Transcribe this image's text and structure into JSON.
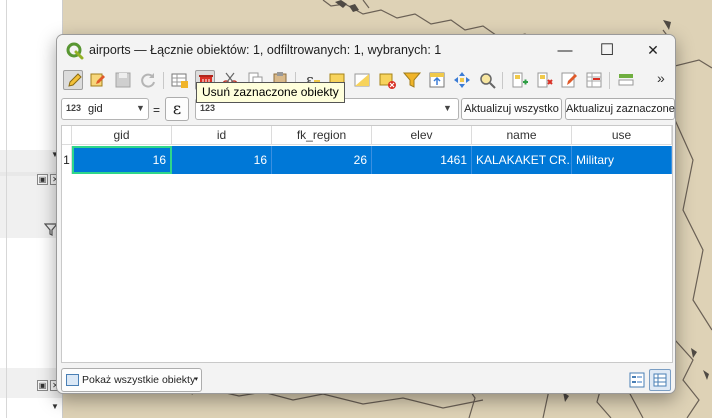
{
  "window": {
    "title": "airports — Łącznie obiektów: 1, odfiltrowanych: 1, wybranych: 1",
    "minimize_glyph": "—",
    "maximize_glyph": "☐",
    "close_glyph": "✕"
  },
  "toolbar": {
    "overflow_glyph": "»",
    "icons": [
      "pencil-edit-icon",
      "multi-edit-icon",
      "save-icon",
      "reload-icon",
      "add-feature-icon",
      "delete-selected-icon",
      "cut-icon",
      "copy-icon",
      "paste-icon",
      "expression-select-icon",
      "select-all-icon",
      "invert-selection-icon",
      "deselect-icon",
      "filter-icon",
      "move-selection-top-icon",
      "pan-to-selection-icon",
      "zoom-to-selection-icon",
      "new-field-icon",
      "delete-field-icon",
      "field-calculator-icon",
      "conditional-format-icon",
      "dock-icon"
    ]
  },
  "tooltip": {
    "text": "Usuń zaznaczone obiekty"
  },
  "filterbar": {
    "field_type": "123",
    "field_name": "gid",
    "equals": "=",
    "expression_glyph": "ε",
    "value_type": "123",
    "update_all_label": "Aktualizuj wszystko",
    "update_selected_label": "Aktualizuj zaznaczone"
  },
  "table": {
    "columns": [
      "gid",
      "id",
      "fk_region",
      "elev",
      "name",
      "use"
    ],
    "rows": [
      {
        "row_number": "1",
        "gid": "16",
        "id": "16",
        "fk_region": "26",
        "elev": "1461",
        "name": "KALAKAKET CR...",
        "use": "Military"
      }
    ]
  },
  "bottombar": {
    "filter_label": "Pokaż wszystkie obiekty"
  },
  "colors": {
    "selection": "#0078d7",
    "focus_border": "#2fd68a",
    "map_background": "#ded2b6",
    "tooltip_background": "#ffffdc"
  }
}
